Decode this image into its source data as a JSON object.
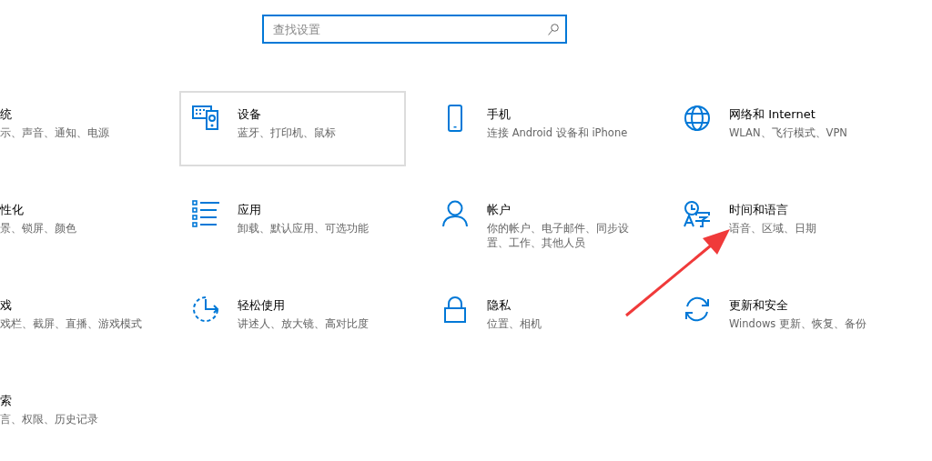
{
  "search": {
    "placeholder": "查找设置"
  },
  "tiles": [
    {
      "kind": "cut",
      "title": "统",
      "subtitle": "示、声音、通知、电源",
      "hovered": false
    },
    {
      "kind": "devices",
      "title": "设备",
      "subtitle": "蓝牙、打印机、鼠标",
      "hovered": true
    },
    {
      "kind": "phone",
      "title": "手机",
      "subtitle": "连接 Android 设备和 iPhone",
      "hovered": false
    },
    {
      "kind": "network",
      "title": "网络和 Internet",
      "subtitle": "WLAN、飞行模式、VPN",
      "hovered": false
    },
    {
      "kind": "cut",
      "title": "性化",
      "subtitle": "景、锁屏、颜色",
      "hovered": false
    },
    {
      "kind": "apps",
      "title": "应用",
      "subtitle": "卸载、默认应用、可选功能",
      "hovered": false
    },
    {
      "kind": "accounts",
      "title": "帐户",
      "subtitle": "你的帐户、电子邮件、同步设置、工作、其他人员",
      "hovered": false
    },
    {
      "kind": "language",
      "title": "时间和语言",
      "subtitle": "语音、区域、日期",
      "hovered": false
    },
    {
      "kind": "cut",
      "title": "戏",
      "subtitle": "戏栏、截屏、直播、游戏模式",
      "hovered": false
    },
    {
      "kind": "ease",
      "title": "轻松使用",
      "subtitle": "讲述人、放大镜、高对比度",
      "hovered": false
    },
    {
      "kind": "privacy",
      "title": "隐私",
      "subtitle": "位置、相机",
      "hovered": false
    },
    {
      "kind": "update",
      "title": "更新和安全",
      "subtitle": "Windows 更新、恢复、备份",
      "hovered": false
    },
    {
      "kind": "cut",
      "title": "索",
      "subtitle": "言、权限、历史记录",
      "hovered": false
    }
  ]
}
